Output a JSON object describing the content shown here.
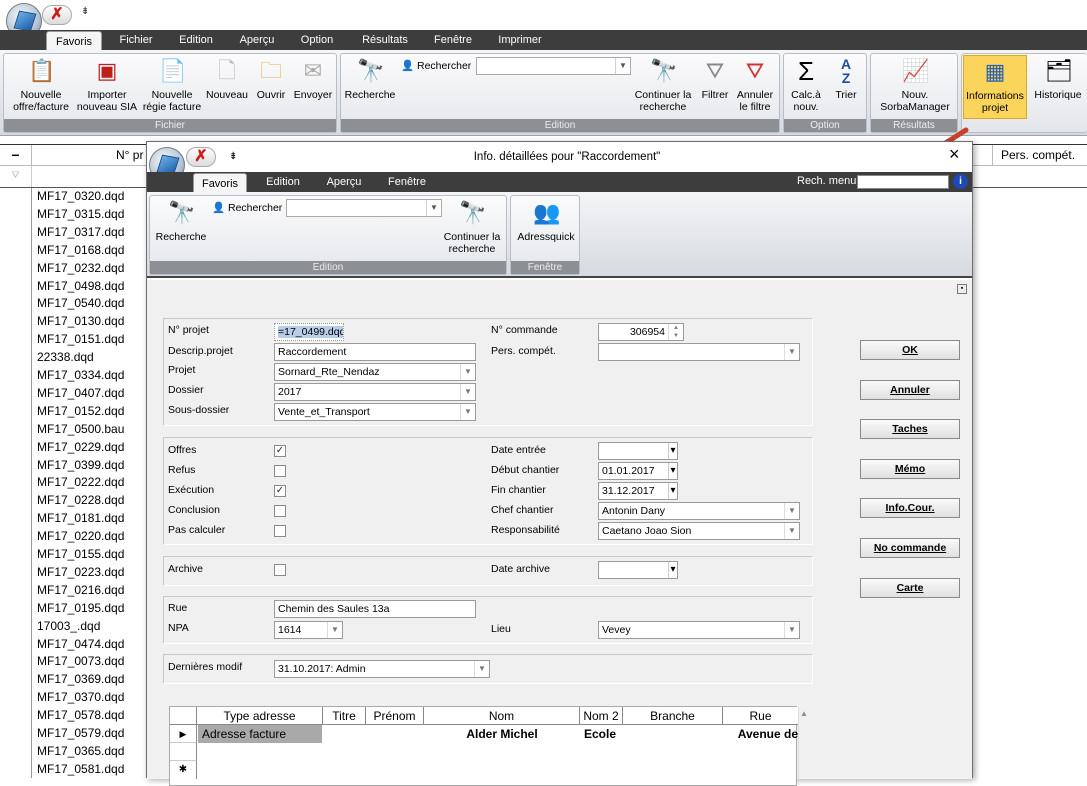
{
  "main": {
    "qat_symbol": "⇟",
    "menu_tabs": [
      "Favoris",
      "Fichier",
      "Edition",
      "Aperçu",
      "Option",
      "Résultats",
      "Fenêtre",
      "Imprimer"
    ],
    "ribbon": {
      "fichier": {
        "caption": "Fichier",
        "buttons": [
          {
            "label": "Nouvelle offre/facture",
            "icon": "new-offer-icon"
          },
          {
            "label": "Importer nouveau SIA",
            "icon": "import-sia-icon"
          },
          {
            "label": "Nouvelle régie facture",
            "icon": "new-invoice-icon"
          },
          {
            "label": "Nouveau",
            "icon": "new-document-icon"
          },
          {
            "label": "Ouvrir",
            "icon": "folder-open-icon"
          },
          {
            "label": "Envoyer",
            "icon": "envelope-icon"
          }
        ]
      },
      "edition": {
        "caption": "Edition",
        "search_label": "Recherche",
        "rechercher_label": "Rechercher",
        "rechercher_value": "",
        "continue_label": "Continuer la recherche",
        "filter_label": "Filtrer",
        "cancel_filter_label": "Annuler le filtre"
      },
      "option": {
        "caption": "Option",
        "calc_label": "Calc.à nouv.",
        "sort_label": "Trier"
      },
      "resultats": {
        "caption": "Résultats",
        "sorba_label": "Nouv. SorbaManager"
      },
      "info_label": "Informations projet",
      "history_label": "Historique"
    },
    "grid": {
      "col_projet": "N° pr",
      "col_pers": "Pers. compét.",
      "rows": [
        "MF17_0320.dqd",
        "MF17_0315.dqd",
        "MF17_0317.dqd",
        "MF17_0168.dqd",
        "MF17_0232.dqd",
        "MF17_0498.dqd",
        "MF17_0540.dqd",
        "MF17_0130.dqd",
        "MF17_0151.dqd",
        "22338.dqd",
        "MF17_0334.dqd",
        "MF17_0407.dqd",
        "MF17_0152.dqd",
        "MF17_0500.bau",
        "MF17_0229.dqd",
        "MF17_0399.dqd",
        "MF17_0222.dqd",
        "MF17_0228.dqd",
        "MF17_0181.dqd",
        "MF17_0220.dqd",
        "MF17_0155.dqd",
        "MF17_0223.dqd",
        "MF17_0216.dqd",
        "MF17_0195.dqd",
        "17003_.dqd",
        "MF17_0474.dqd",
        "MF17_0073.dqd",
        "MF17_0369.dqd",
        "MF17_0370.dqd",
        "MF17_0578.dqd",
        "MF17_0579.dqd",
        "MF17_0365.dqd",
        "MF17_0581.dqd"
      ]
    }
  },
  "dialog": {
    "title": "Info. détaillées pour  \"Raccordement\"",
    "close_symbol": "×",
    "menu_tabs": [
      "Favoris",
      "Edition",
      "Aperçu",
      "Fenêtre"
    ],
    "rech_menu_label": "Rech. menu",
    "rech_menu_value": "",
    "ribbon": {
      "edition_caption": "Edition",
      "search_label": "Recherche",
      "rechercher_label": "Rechercher",
      "rechercher_value": "",
      "continue_label": "Continuer la recherche",
      "fenetre_caption": "Fenêtre",
      "adressquick_label": "Adressquick"
    },
    "form": {
      "no_projet_label": "N° projet",
      "no_projet_value": "=17_0499.dqd",
      "descrip_label": "Descrip.projet",
      "descrip_value": "Raccordement",
      "projet_label": "Projet",
      "projet_value": "Sornard_Rte_Nendaz",
      "dossier_label": "Dossier",
      "dossier_value": "2017",
      "sous_dossier_label": "Sous-dossier",
      "sous_dossier_value": "Vente_et_Transport",
      "commande_label": "N° commande",
      "commande_value": "306954",
      "pers_label": "Pers. compét.",
      "pers_value": "",
      "offres_label": "Offres",
      "offres_checked": "✓",
      "refus_label": "Refus",
      "refus_checked": "",
      "execution_label": "Exécution",
      "execution_checked": "✓",
      "conclusion_label": "Conclusion",
      "conclusion_checked": "",
      "pas_calculer_label": "Pas calculer",
      "pas_calculer_checked": "",
      "date_entree_label": "Date entrée",
      "date_entree_value": "",
      "debut_label": "Début chantier",
      "debut_value": "01.01.2017",
      "fin_label": "Fin chantier",
      "fin_value": "31.12.2017",
      "chef_label": "Chef chantier",
      "chef_value": "Antonin Dany",
      "resp_label": "Responsabilité",
      "resp_value": "Caetano Joao Sion",
      "archive_label": "Archive",
      "archive_checked": "",
      "date_archive_label": "Date archive",
      "date_archive_value": "",
      "rue_label": "Rue",
      "rue_value": "Chemin des Saules 13a",
      "npa_label": "NPA",
      "npa_value": "1614",
      "lieu_label": "Lieu",
      "lieu_value": "Vevey",
      "modif_label": "Dernières modif",
      "modif_value": "31.10.2017: Admin"
    },
    "buttons": [
      "OK",
      "Annuler",
      "Taches",
      "Mémo",
      "Info.Cour.",
      "No commande",
      "Carte"
    ],
    "address_grid": {
      "columns": [
        "Type adresse",
        "Titre",
        "Prénom",
        "Nom",
        "Nom 2",
        "Branche",
        "Rue"
      ],
      "row": {
        "type": "Adresse facture",
        "titre": "",
        "prenom": "",
        "nom": "Alder Michel",
        "nom2": "Ecole",
        "branche": "",
        "rue": "Avenue de"
      },
      "current_marker": "▶",
      "new_marker": "✱"
    }
  },
  "colors": {
    "menubar": "#3d3d3d",
    "arrow": "#c8412f",
    "selection": "#b7cde8",
    "caption": "#8c8f94"
  }
}
